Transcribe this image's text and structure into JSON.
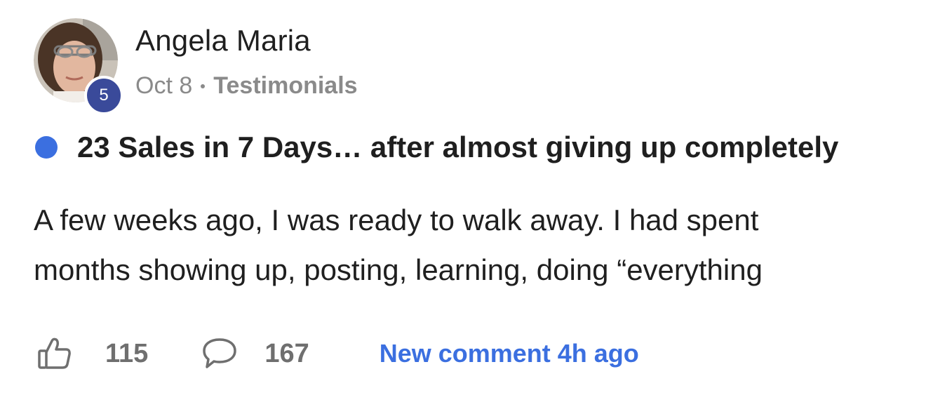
{
  "author": {
    "name": "Angela Maria",
    "level": "5"
  },
  "meta": {
    "date": "Oct 8",
    "category": "Testimonials"
  },
  "post": {
    "title": "23 Sales in 7 Days… after almost giving up completely",
    "body_lines": [
      "A few weeks ago, I was ready to walk away. I had spent",
      "months showing up, posting, learning, doing “everything"
    ]
  },
  "footer": {
    "likes": "115",
    "comments": "167",
    "new_comment": "New comment 4h ago"
  },
  "colors": {
    "accent": "#3b6fe0",
    "badge": "#3a4a9a",
    "muted": "#8a8a8a"
  },
  "icons": {
    "like": "thumbs-up-icon",
    "comment": "speech-bubble-icon",
    "unread": "unread-dot"
  }
}
